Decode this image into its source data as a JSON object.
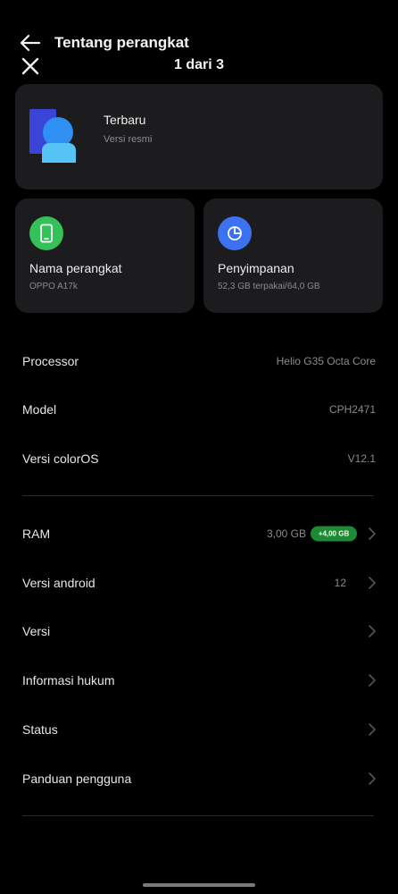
{
  "header": {
    "title": "Tentang perangkat",
    "pager": "1 dari 3",
    "back_icon": "arrow-left-icon",
    "close_icon": "close-icon"
  },
  "os_card": {
    "title": "Terbaru",
    "subtitle": "Versi resmi",
    "icon": "coloros-logo-icon"
  },
  "device_card": {
    "title": "Nama perangkat",
    "value": "OPPO A17k",
    "icon": "phone-icon",
    "color": "#35c15a"
  },
  "storage_card": {
    "title": "Penyimpanan",
    "value": "52,3 GB terpakai/64,0 GB",
    "icon": "pie-chart-icon",
    "color": "#3c72f0"
  },
  "specs": [
    {
      "label": "Processor",
      "value": "Helio G35 Octa Core"
    },
    {
      "label": "Model",
      "value": "CPH2471"
    },
    {
      "label": "Versi colorOS",
      "value": "V12.1"
    }
  ],
  "menu": {
    "ram": {
      "label": "RAM",
      "value": "3,00 GB",
      "badge": "+4,00 GB",
      "badge_color": "#1f8a35"
    },
    "android": {
      "label": "Versi android",
      "value": "12"
    },
    "versi": {
      "label": "Versi"
    },
    "legal": {
      "label": "Informasi hukum"
    },
    "status": {
      "label": "Status"
    },
    "guide": {
      "label": "Panduan pengguna"
    }
  }
}
